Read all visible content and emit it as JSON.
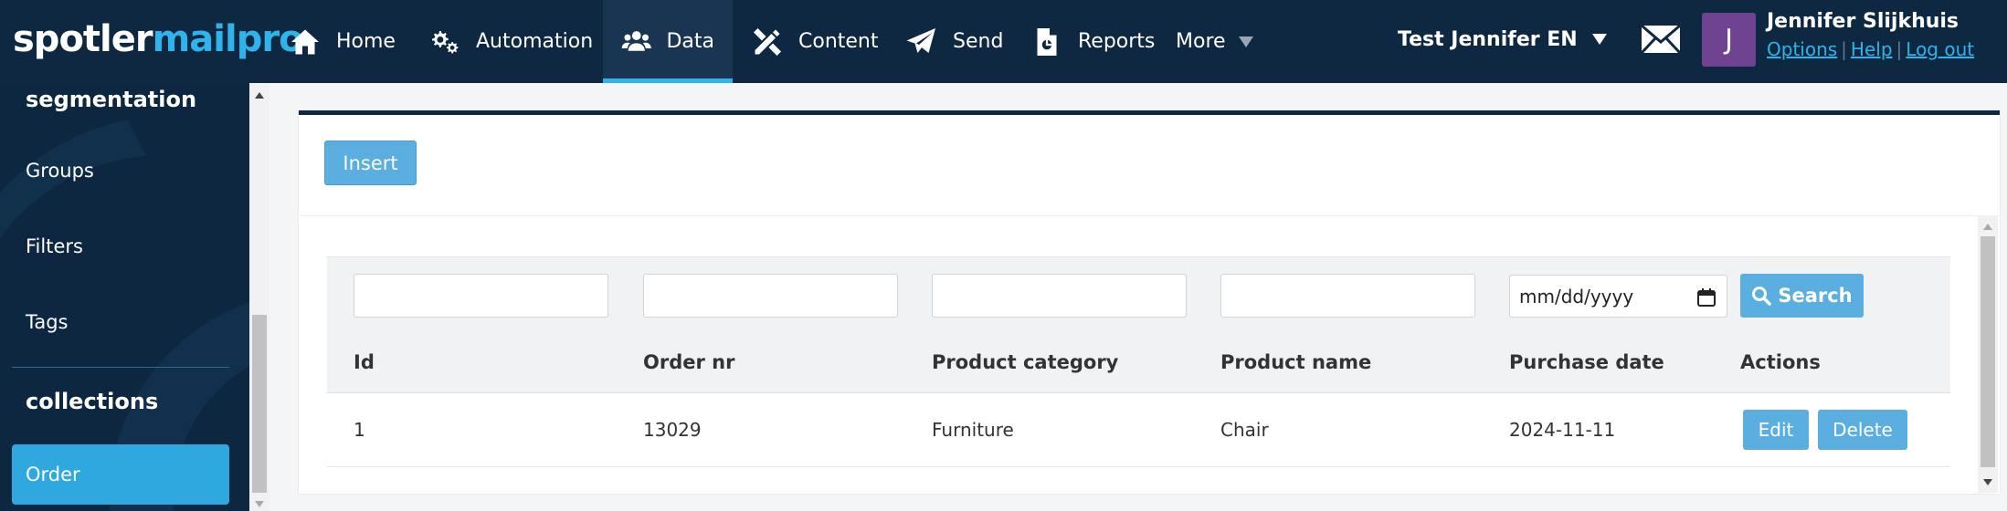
{
  "logo": {
    "part1": "spotler",
    "part2": "mailpro"
  },
  "nav": {
    "home": "Home",
    "automation": "Automation",
    "data": "Data",
    "content": "Content",
    "send": "Send",
    "reports": "Reports",
    "more": "More"
  },
  "account": {
    "name": "Test Jennifer EN"
  },
  "user": {
    "initial": "J",
    "name": "Jennifer Slijkhuis",
    "options": "Options",
    "help": "Help",
    "logout": "Log out"
  },
  "sidebar": {
    "segmentation_heading": "segmentation",
    "groups": "Groups",
    "filters": "Filters",
    "tags": "Tags",
    "collections_heading": "collections",
    "order": "Order"
  },
  "toolbar": {
    "insert_label": "Insert"
  },
  "filters": {
    "date_placeholder": "mm/dd/yyyy",
    "search_label": "Search"
  },
  "table": {
    "columns": [
      "Id",
      "Order nr",
      "Product category",
      "Product name",
      "Purchase date",
      "Actions"
    ],
    "rows": [
      {
        "id": "1",
        "order_nr": "13029",
        "category": "Furniture",
        "product": "Chair",
        "date": "2024-11-11"
      }
    ],
    "edit_label": "Edit",
    "delete_label": "Delete"
  },
  "colors": {
    "nav_bg": "#0f2841",
    "accent": "#2fb3ea",
    "button": "#5aaee0",
    "avatar": "#6f4392"
  }
}
